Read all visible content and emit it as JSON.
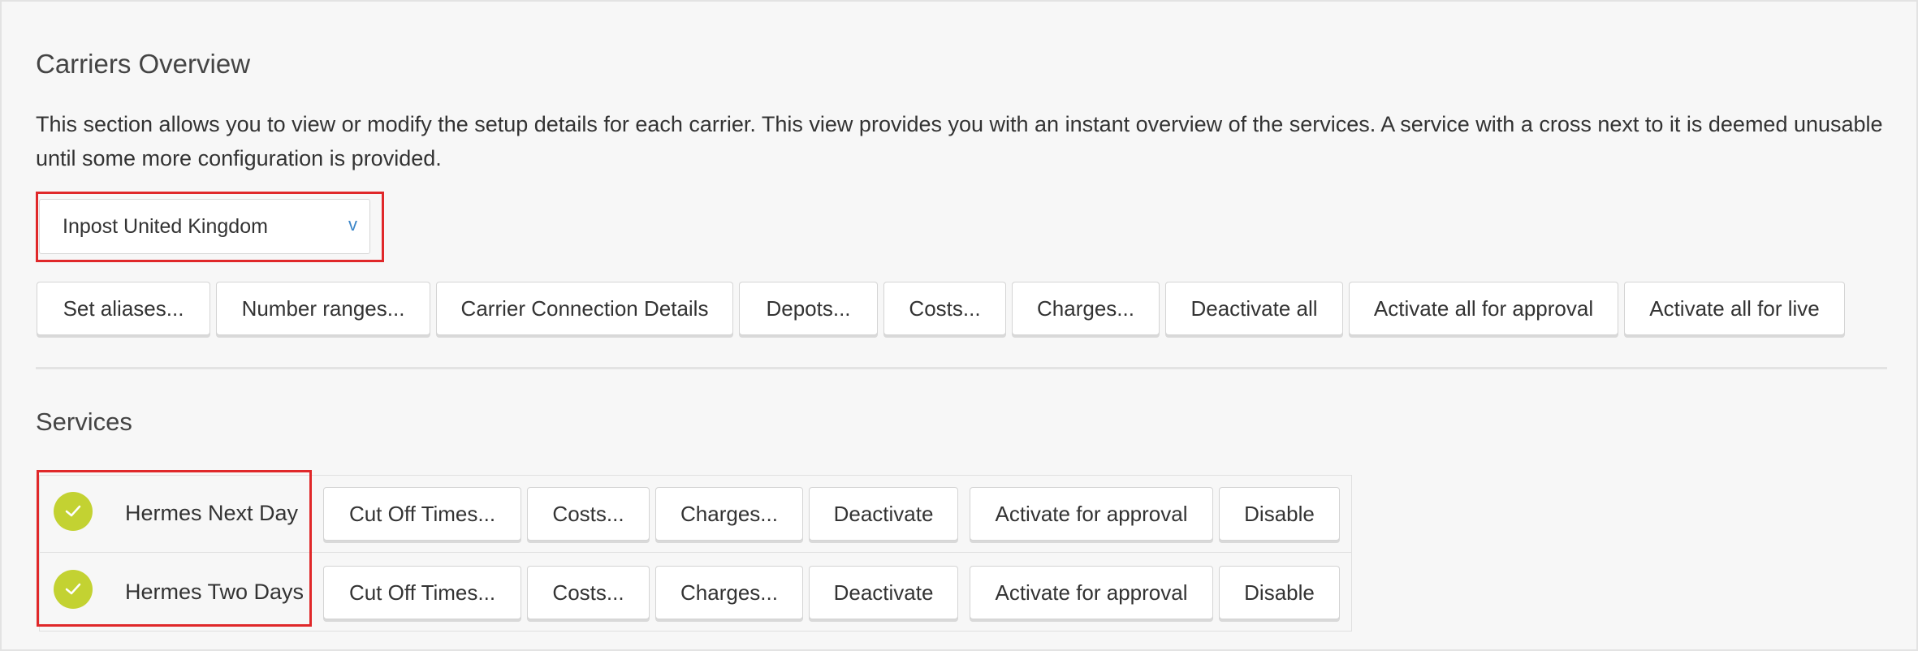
{
  "header": {
    "title": "Carriers Overview",
    "description": "This section allows you to view or modify the setup details for each carrier. This view provides you with an instant overview of the services. A service with a cross next to it is deemed unusable until some more configuration is provided."
  },
  "carrier_select": {
    "selected": "Inpost United Kingdom",
    "caret": "v",
    "caret_icon": "chevron-down-icon"
  },
  "carrier_actions": [
    "Set aliases...",
    "Number ranges...",
    "Carrier Connection Details",
    "Depots...",
    "Costs...",
    "Charges...",
    "Deactivate all",
    "Activate all for approval",
    "Activate all for live"
  ],
  "services": {
    "title": "Services",
    "items": [
      {
        "name": "Hermes Next Day",
        "status_icon": "check-icon",
        "status_color": "#c3d232",
        "actions": [
          "Cut Off Times...",
          "Costs...",
          "Charges...",
          "Deactivate",
          "Activate for approval",
          "Disable"
        ]
      },
      {
        "name": "Hermes Two Days",
        "status_icon": "check-icon",
        "status_color": "#c3d232",
        "actions": [
          "Cut Off Times...",
          "Costs...",
          "Charges...",
          "Deactivate",
          "Activate for approval",
          "Disable"
        ]
      }
    ]
  },
  "colors": {
    "highlight": "#e0282a",
    "accent": "#3b86c8"
  }
}
